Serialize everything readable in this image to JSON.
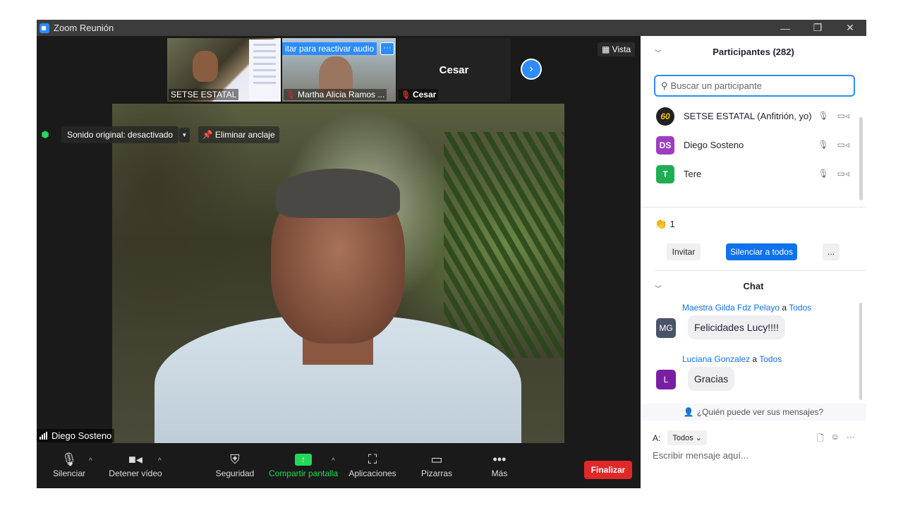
{
  "window": {
    "title": "Zoom Reunión",
    "controls": [
      "—",
      "❐",
      "✕"
    ]
  },
  "strip": {
    "thumbs": [
      {
        "label": "SETSE ESTATAL"
      },
      {
        "label": "Martha Alicia Ramos ...",
        "banner": "itar para reactivar audio",
        "banner_dots": "···"
      },
      {
        "name": "Cesar",
        "label": "Cesar"
      }
    ],
    "next_icon": "›"
  },
  "vista": "Vista",
  "overlay": {
    "sonido": "Sonido original: desactivado",
    "caret": "▾",
    "unpin": "Eliminar anclaje"
  },
  "speaker": {
    "name": "Diego Sosteno"
  },
  "toolbar": {
    "mute": "Silenciar",
    "video": "Detener vídeo",
    "security": "Seguridad",
    "share": "Compartir pantalla",
    "apps": "Aplicaciones",
    "whiteboards": "Pizarras",
    "more": "Más",
    "end": "Finalizar"
  },
  "participants": {
    "title": "Participantes (282)",
    "search_placeholder": "Buscar un participante",
    "list": [
      {
        "avatar": "60",
        "name": "SETSE ESTATAL (Anfitrión, yo)",
        "color": "#222222"
      },
      {
        "avatar": "DS",
        "name": "Diego Sosteno",
        "color": "#9b3fbf"
      },
      {
        "avatar": "T",
        "name": "Tere",
        "color": "#1fae52"
      }
    ],
    "reaction_count": "1",
    "invite": "Invitar",
    "mute_all": "Silenciar a todos",
    "more": "..."
  },
  "chat": {
    "title": "Chat",
    "messages": [
      {
        "from": "Maestra Gilda Fdz Pelayo",
        "to_word": "a",
        "to": "Todos",
        "avatar": "MG",
        "avatar_color": "#4a5468",
        "text": "Felicidades Lucy!!!!"
      },
      {
        "from": "Luciana Gonzalez",
        "to_word": "a",
        "to": "Todos",
        "avatar": "L",
        "avatar_color": "#7b1fa2",
        "text": "Gracias"
      }
    ],
    "who_sees": "¿Quién puede ver sus mensajes?",
    "to_label": "A:",
    "to_value": "Todos",
    "input_placeholder": "Escribir mensaje aquí..."
  }
}
